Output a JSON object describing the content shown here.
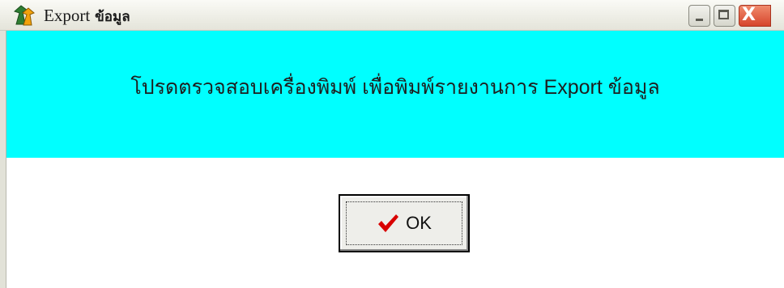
{
  "window": {
    "title_main": "Export",
    "title_thai": "ข้อมูล",
    "app_icon": "app-tree-icon",
    "controls": {
      "minimize_icon": "minimize-icon",
      "maximize_icon": "maximize-icon",
      "close_icon": "close-icon",
      "close_glyph": "X"
    }
  },
  "banner": {
    "message": "โปรดตรวจสอบเครื่องพิมพ์  เพื่อพิมพ์รายงานการ Export ข้อมูล",
    "background_color": "#00ffff"
  },
  "ok_button": {
    "label": "OK",
    "icon": "checkmark-icon",
    "icon_color": "#d80000"
  }
}
